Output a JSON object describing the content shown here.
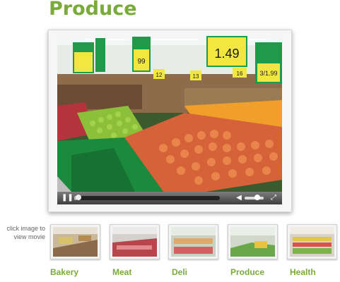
{
  "page": {
    "title": "Produce"
  },
  "player": {
    "video_alt": "produce section video",
    "progress": 0.02,
    "volume": 0.65,
    "controls": {
      "play_icon": "pause-icon",
      "volume_icon": "speaker-icon",
      "fullscreen_icon": "fullscreen-icon"
    }
  },
  "store_signs": [
    "1.49",
    "99",
    "3/1.99",
    "12",
    "16",
    "13"
  ],
  "hint": {
    "line1": "click image to",
    "line2": "view movie"
  },
  "thumbnails": [
    {
      "label": "Bakery"
    },
    {
      "label": "Meat"
    },
    {
      "label": "Deli"
    },
    {
      "label": "Produce"
    },
    {
      "label": "Health"
    }
  ],
  "colors": {
    "accent": "#7aab3a",
    "sign_yellow": "#f2e640",
    "sign_green": "#1f9a4a"
  }
}
